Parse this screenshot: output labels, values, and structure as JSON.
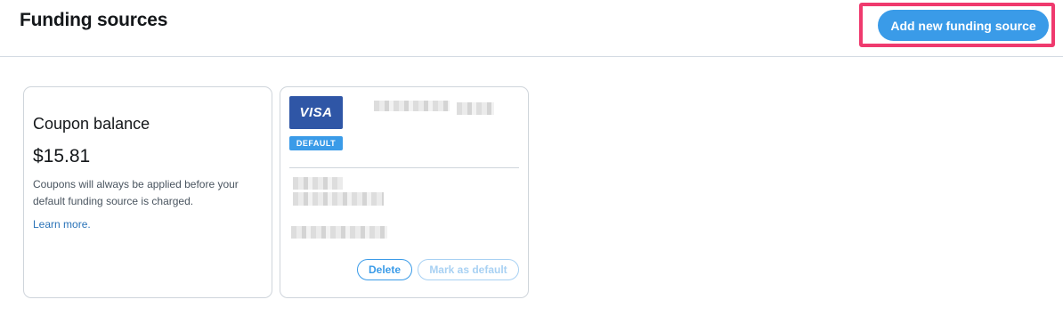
{
  "header": {
    "title": "Funding sources",
    "add_button_label": "Add new funding source"
  },
  "coupon_card": {
    "title": "Coupon balance",
    "amount": "$15.81",
    "description": "Coupons will always be applied before your default funding source is charged.",
    "link_label": "Learn more."
  },
  "funding_card": {
    "brand_label": "VISA",
    "badge_label": "DEFAULT",
    "delete_label": "Delete",
    "mark_default_label": "Mark as default"
  },
  "colors": {
    "accent": "#3a9be8",
    "highlight": "#ef3a6e",
    "visa_blue": "#2f56a6",
    "link": "#2a73b8"
  }
}
